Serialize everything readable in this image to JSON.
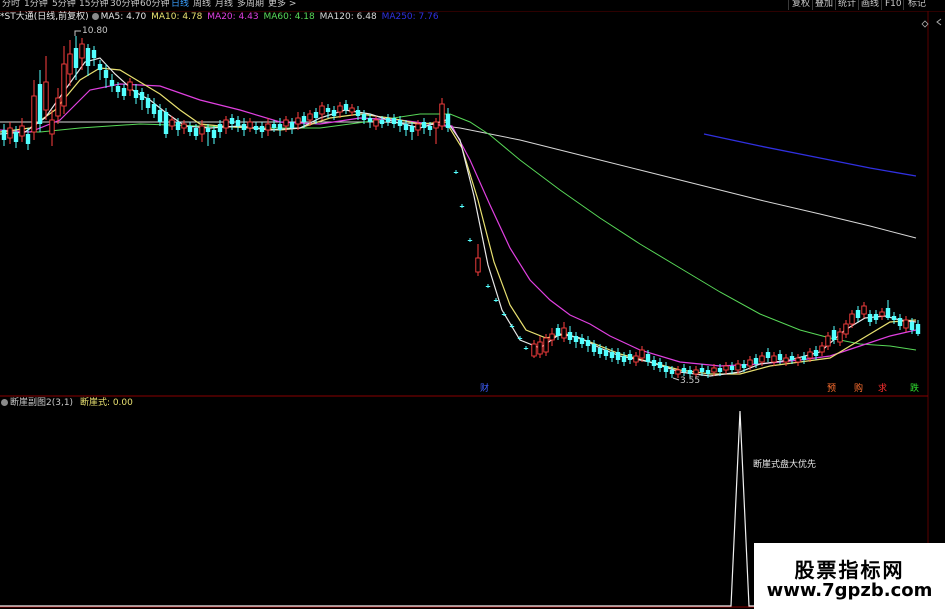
{
  "period_tabs": [
    "分时",
    "1分钟",
    "5分钟",
    "15分钟",
    "30分钟",
    "60分钟",
    "日线",
    "周线",
    "月线",
    "多周期",
    "更多 >"
  ],
  "active_period": "日线",
  "right_buttons": [
    "复权",
    "叠加",
    "统计",
    "画线",
    "F10",
    "标记"
  ],
  "header_icons": [
    "diamond-icon",
    "chevron-left-icon"
  ],
  "stock_title": "*ST大通(日线,前复权)",
  "ma": [
    {
      "label": "MA5: 4.70",
      "color": "#e8e8e8"
    },
    {
      "label": "MA10: 4.78",
      "color": "#e8e070"
    },
    {
      "label": "MA20: 4.43",
      "color": "#e040e0"
    },
    {
      "label": "MA60: 4.18",
      "color": "#58d858"
    },
    {
      "label": "MA120: 6.48",
      "color": "#d8d8d8"
    },
    {
      "label": "MA250: 7.76",
      "color": "#3030e0"
    }
  ],
  "high_label": "10.80",
  "low_label": "3.55",
  "event_flags": [
    {
      "text": "财",
      "color": "#4060ff"
    },
    {
      "text": "预",
      "color": "#ff7030"
    },
    {
      "text": "购",
      "color": "#ff7030"
    },
    {
      "text": "求",
      "color": "#ff3030"
    },
    {
      "text": "跌",
      "color": "#30e030"
    }
  ],
  "indicator": {
    "name": "断崖副图2(3,1)",
    "value_label": "断崖式: 0.00",
    "annotation": "断崖式盘大优先"
  },
  "watermark": {
    "line1": "股票指标网",
    "line2": "www.7gpzb.com"
  },
  "colors": {
    "up": "#ff4040",
    "down": "#54ffff",
    "ma5": "#e8e8e8",
    "ma10": "#e8e070",
    "ma20": "#e040e0",
    "ma60": "#58d858",
    "ma120": "#d8d8d8",
    "ma250": "#3030e0",
    "active_tab": "#3aa0ff",
    "indicator_value": "#e8e070"
  }
}
